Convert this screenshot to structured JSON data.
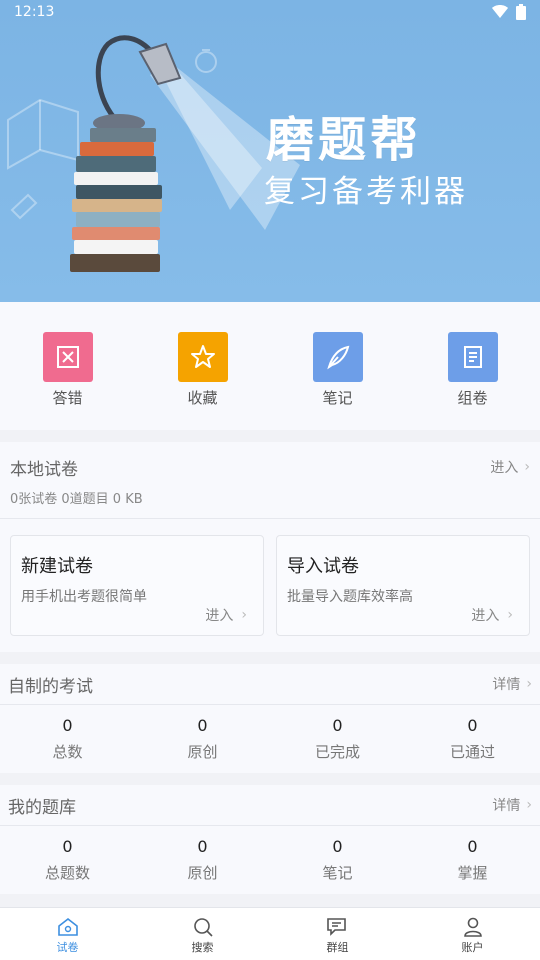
{
  "status_bar": {
    "time": "12:13"
  },
  "banner": {
    "title": "磨题帮",
    "subtitle": "复习备考利器"
  },
  "quick_actions": [
    {
      "label": "答错",
      "icon": "wrong-answers-icon",
      "color": "#f06b8f"
    },
    {
      "label": "收藏",
      "icon": "star-icon",
      "color": "#f5a300"
    },
    {
      "label": "笔记",
      "icon": "quill-icon",
      "color": "#6d9ee8"
    },
    {
      "label": "组卷",
      "icon": "document-icon",
      "color": "#6d9ee8"
    }
  ],
  "local_papers": {
    "title": "本地试卷",
    "link": "进入",
    "stats": "0张试卷 0道题目 0 KB",
    "cards": [
      {
        "title": "新建试卷",
        "desc": "用手机出考题很简单",
        "link": "进入"
      },
      {
        "title": "导入试卷",
        "desc": "批量导入题库效率高",
        "link": "进入"
      }
    ]
  },
  "my_exams": {
    "title": "自制的考试",
    "link": "详情",
    "stats": [
      {
        "value": "0",
        "label": "总数"
      },
      {
        "value": "0",
        "label": "原创"
      },
      {
        "value": "0",
        "label": "已完成"
      },
      {
        "value": "0",
        "label": "已通过"
      }
    ]
  },
  "my_bank": {
    "title": "我的题库",
    "link": "详情",
    "stats": [
      {
        "value": "0",
        "label": "总题数"
      },
      {
        "value": "0",
        "label": "原创"
      },
      {
        "value": "0",
        "label": "笔记"
      },
      {
        "value": "0",
        "label": "掌握"
      }
    ]
  },
  "bottom_nav": [
    {
      "label": "试卷",
      "icon": "home-icon",
      "active": true
    },
    {
      "label": "搜索",
      "icon": "search-icon",
      "active": false
    },
    {
      "label": "群组",
      "icon": "chat-icon",
      "active": false
    },
    {
      "label": "账户",
      "icon": "user-icon",
      "active": false
    }
  ],
  "colors": {
    "accent": "#3d8fe0",
    "banner": "#7cb4e4"
  }
}
